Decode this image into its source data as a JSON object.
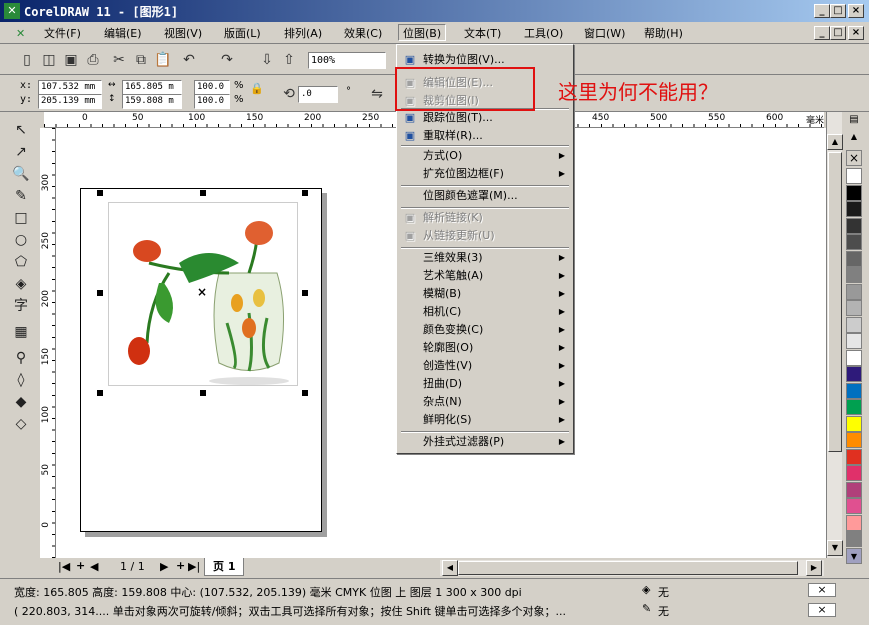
{
  "window": {
    "title": "CorelDRAW 11 - [图形1]",
    "logo": "coreldraw-logo"
  },
  "menubar": {
    "items": [
      {
        "label": "文件(F)"
      },
      {
        "label": "编辑(E)"
      },
      {
        "label": "视图(V)"
      },
      {
        "label": "版面(L)"
      },
      {
        "label": "排列(A)"
      },
      {
        "label": "效果(C)"
      },
      {
        "label": "位图(B)"
      },
      {
        "label": "文本(T)"
      },
      {
        "label": "工具(O)"
      },
      {
        "label": "窗口(W)"
      },
      {
        "label": "帮助(H)"
      }
    ]
  },
  "toolbar": {
    "zoom": "100%"
  },
  "propbar": {
    "x": "107.532 mm",
    "y": "205.139 mm",
    "w": "165.805 m",
    "h": "159.808 m",
    "sx": "100.0",
    "sy": "100.0",
    "pct": "%",
    "angle": ".0",
    "deg": "°"
  },
  "ruler": {
    "h_ticks": [
      "0",
      "50",
      "100",
      "150",
      "200",
      "250",
      "450",
      "500",
      "550",
      "600"
    ],
    "unit": "毫米",
    "v_ticks": [
      "300",
      "250",
      "200",
      "150",
      "100",
      "50",
      "0"
    ]
  },
  "bitmap_menu": {
    "items": [
      {
        "label": "转换为位图(V)...",
        "state": "enabled",
        "icon": "bitmap-icon"
      },
      {
        "label": "编辑位图(E)...",
        "state": "disabled",
        "icon": "edit-bitmap-icon"
      },
      {
        "label": "裁剪位图(I)",
        "state": "disabled",
        "icon": "crop-bitmap-icon"
      },
      {
        "label": "跟踪位图(T)...",
        "state": "enabled",
        "icon": "trace-bitmap-icon"
      },
      {
        "label": "重取样(R)...",
        "state": "enabled",
        "icon": "resample-icon"
      },
      {
        "label": "方式(O)",
        "state": "submenu"
      },
      {
        "label": "扩充位图边框(F)",
        "state": "submenu"
      },
      {
        "label": "位图颜色遮罩(M)...",
        "state": "enabled"
      },
      {
        "label": "解析链接(K)",
        "state": "disabled",
        "icon": "link-icon"
      },
      {
        "label": "从链接更新(U)",
        "state": "disabled",
        "icon": "update-link-icon"
      },
      {
        "label": "三维效果(3)",
        "state": "submenu"
      },
      {
        "label": "艺术笔触(A)",
        "state": "submenu"
      },
      {
        "label": "模糊(B)",
        "state": "submenu"
      },
      {
        "label": "相机(C)",
        "state": "submenu"
      },
      {
        "label": "颜色变换(C)",
        "state": "submenu"
      },
      {
        "label": "轮廓图(O)",
        "state": "submenu"
      },
      {
        "label": "创造性(V)",
        "state": "submenu"
      },
      {
        "label": "扭曲(D)",
        "state": "submenu"
      },
      {
        "label": "杂点(N)",
        "state": "submenu"
      },
      {
        "label": "鲜明化(S)",
        "state": "submenu"
      },
      {
        "label": "外挂式过滤器(P)",
        "state": "submenu"
      }
    ]
  },
  "annotation": {
    "text": "这里为何不能用？",
    "color": "#e01010"
  },
  "pagetabs": {
    "counter": "1 / 1",
    "page": "页 1"
  },
  "status": {
    "line1": "宽度: 165.805  高度: 159.808  中心: (107.532, 205.139)  毫米     CMYK 位图 上 图层 1 300 x 300 dpi",
    "fill": "无",
    "line2": "( 220.803, 314....  单击对象两次可旋转/倾斜；双击工具可选择所有对象；按住 Shift 键单击可选择多个对象；...",
    "outline": "无"
  },
  "palette": [
    "#ffffff",
    "#000000",
    "#1a1a1a",
    "#333333",
    "#4d4d4d",
    "#666666",
    "#808080",
    "#999999",
    "#b3b3b3",
    "#cccccc",
    "#e6e6e6",
    "#ffffff",
    "#2e1a7a",
    "#0070c0",
    "#00a050",
    "#ffff00",
    "#ff8c00",
    "#e03020",
    "#e0306a",
    "#b0407a",
    "#e05090",
    "#ff9a9a",
    "#808080",
    "#a0a0c0"
  ]
}
